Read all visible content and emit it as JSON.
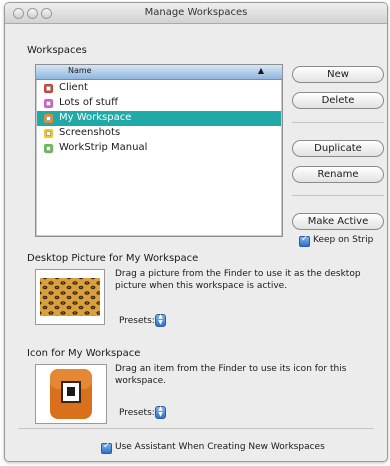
{
  "window": {
    "title": "Manage Workspaces"
  },
  "workspaces": {
    "section_label": "Workspaces",
    "column_header": "Name",
    "sort_icon": "▲",
    "items": [
      {
        "label": "Client",
        "color": "#e23b2c"
      },
      {
        "label": "Lots of stuff",
        "color": "#d85ad6"
      },
      {
        "label": "My Workspace",
        "color": "#f08a1d"
      },
      {
        "label": "Screenshots",
        "color": "#f2c61a"
      },
      {
        "label": "WorkStrip Manual",
        "color": "#4fcc3a"
      }
    ],
    "selected_index": 2,
    "selection_color": "#1faaa8"
  },
  "buttons": {
    "new": "New",
    "delete": "Delete",
    "duplicate": "Duplicate",
    "rename": "Rename",
    "make_active": "Make Active"
  },
  "keep_on_strip": {
    "label": "Keep on Strip",
    "checked": true
  },
  "desktop_picture": {
    "section_label": "Desktop Picture for My Workspace",
    "description_line1": "Drag a picture from the Finder to use it as the desktop",
    "description_line2": "picture when this workspace is active.",
    "presets_label": "Presets:"
  },
  "icon_section": {
    "section_label": "Icon for My Workspace",
    "description_line1": "Drag an item from the Finder to use its icon for this",
    "description_line2": "workspace.",
    "presets_label": "Presets:"
  },
  "assistant": {
    "label": "Use Assistant When Creating New Workspaces",
    "checked": true
  }
}
